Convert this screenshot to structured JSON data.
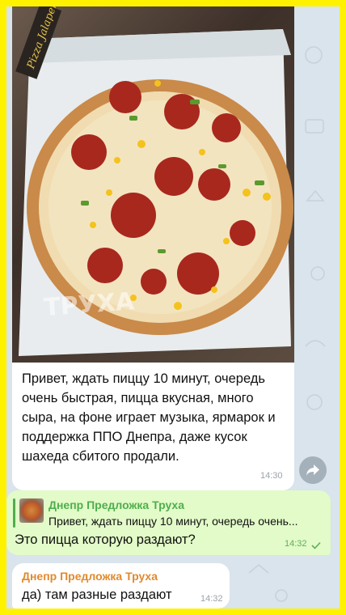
{
  "photo_message": {
    "text": "Привет, ждать пиццу 10 минут, очередь очень быстрая, пицца вкусная, много сыра, на фоне играет музыка, ярмарок и поддержка ППО Днепра, даже кусок шахеда сбитого продали.",
    "time": "14:30",
    "watermark": "ТРУХА",
    "box_print": "Pizza Jalapeño"
  },
  "outgoing_message": {
    "reply_name": "Днепр Предложка Труха",
    "reply_snippet": "Привет, ждать пиццу 10 минут, очередь очень...",
    "text": "Это пицца которую раздают?",
    "time": "14:32",
    "status_icon": "read-check-icon"
  },
  "incoming_message": {
    "sender": "Днепр Предложка Труха",
    "text": "да) там разные раздают",
    "time": "14:32"
  },
  "colors": {
    "frame": "#fff200",
    "chat_bg": "#d9e4ec",
    "outgoing_bg": "#e2fbc8",
    "reply_accent": "#4fae4e",
    "sender_accent": "#e08a2e"
  }
}
